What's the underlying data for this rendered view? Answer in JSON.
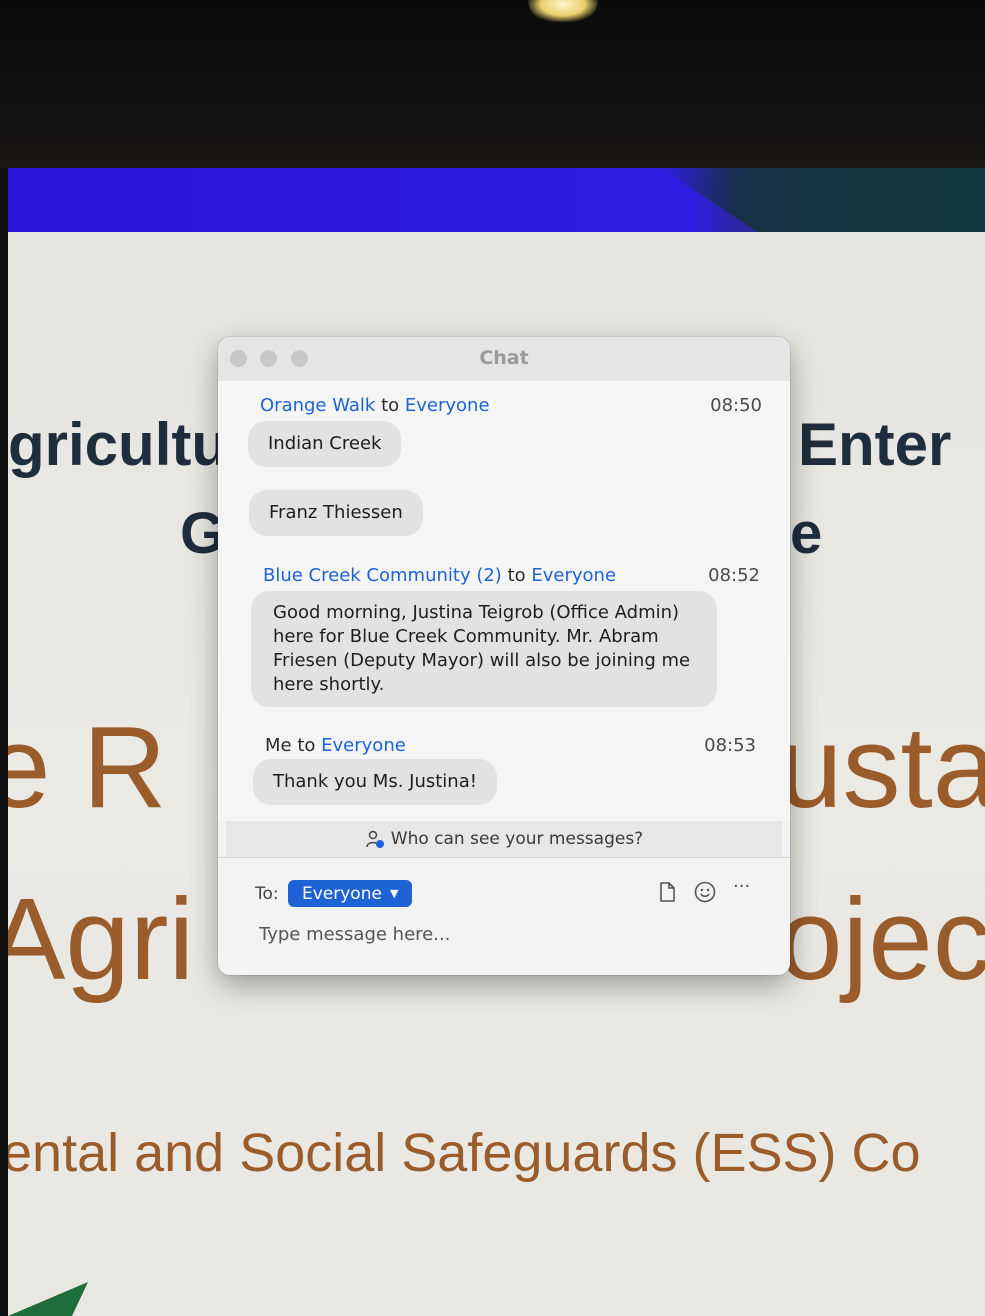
{
  "background": {
    "slide_lines": [
      "gricultu",
      "Enter",
      "G",
      "e",
      "e R",
      "usta",
      "Agri",
      "ojec",
      "ental and Social Safeguards (ESS) Co"
    ]
  },
  "chat": {
    "title": "Chat",
    "messages": [
      {
        "sender": "Orange Walk",
        "connector": "to",
        "recipient": "Everyone",
        "time": "08:50",
        "bubbles": [
          "Indian Creek",
          "Franz Thiessen"
        ]
      },
      {
        "sender": "Blue Creek Community (2)",
        "connector": "to",
        "recipient": "Everyone",
        "time": "08:52",
        "bubbles": [
          "Good morning, Justina Teigrob (Office Admin) here for Blue Creek Community. Mr. Abram Friesen (Deputy Mayor) will also be joining me here shortly."
        ]
      },
      {
        "sender": "Me",
        "connector": "to",
        "recipient": "Everyone",
        "time": "08:53",
        "bubbles": [
          "Thank you Ms. Justina!"
        ]
      }
    ],
    "who_can_see": "Who can see your messages?",
    "composer": {
      "to_label": "To:",
      "recipient": "Everyone",
      "placeholder": "Type message here...",
      "more_label": "···"
    }
  },
  "colors": {
    "accent_blue": "#1d63d6",
    "bubble": "#e3e2e3",
    "slide_navy": "#1f2d3c",
    "slide_brown": "#9a5c2a"
  },
  "icons": [
    "file-icon",
    "emoji-icon",
    "more-icon",
    "people-visibility-icon"
  ]
}
